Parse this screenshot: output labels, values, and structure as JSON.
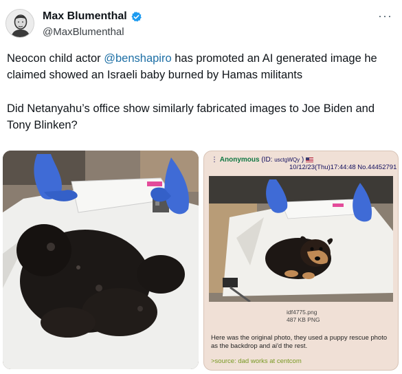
{
  "author": {
    "display_name": "Max Blumenthal",
    "handle": "@MaxBlumenthal",
    "verified_icon": "verified-badge-icon",
    "verified_color": "#1d9bf0"
  },
  "more_glyph": "···",
  "tweet": {
    "p1_prefix": "Neocon child actor ",
    "p1_mention": "@benshapiro",
    "p1_suffix": " has promoted an AI generated image he claimed showed an Israeli baby burned by Hamas militants",
    "p2": "Did Netanyahu’s office show similarly fabricated images to Joe Biden and Tony Blinken?",
    "mention_color": "#1d6fa5"
  },
  "chan_post": {
    "name": "Anonymous",
    "id_open": "(ID: ",
    "id_value": "usctgWQy",
    "id_close": " )",
    "date": "10/12/23(Thu)17:44:48 No.44452791",
    "file_name": "idf4775.png",
    "file_size": "487 KB PNG",
    "comment": "Here was the original photo, they used a puppy rescue photo as the backdrop and ai'd the rest.",
    "quote": ">source: dad works at centcom",
    "name_color": "#117743",
    "quote_color": "#789922",
    "bg_color": "#f0e0d6"
  }
}
